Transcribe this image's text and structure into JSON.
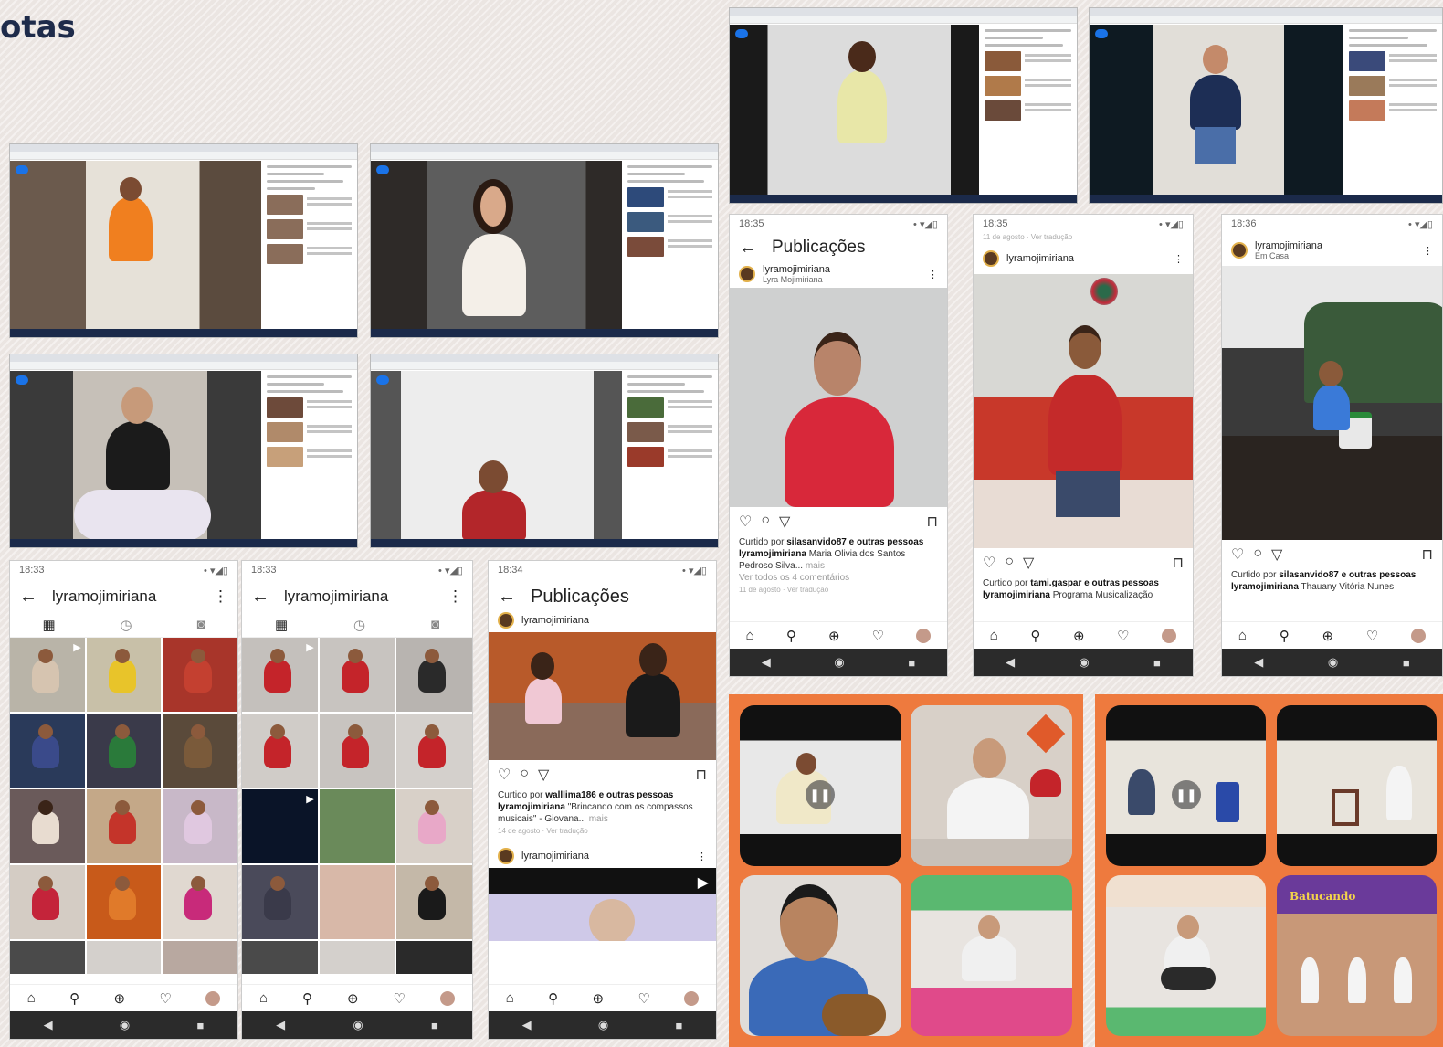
{
  "page": {
    "title": "otas"
  },
  "phones": {
    "p1": {
      "time": "18:33",
      "status": "• ▾◢▯",
      "username": "lyramojimiriana"
    },
    "p2": {
      "time": "18:33",
      "status": "• ▾◢▯",
      "username": "lyramojimiriana"
    },
    "p3": {
      "time": "18:34",
      "status": "• ▾◢▯",
      "header": "Publicações",
      "account": "lyramojimiriana",
      "liked_prefix": "Curtido por",
      "liked_user": "walllima186",
      "liked_suffix": "e outras pessoas",
      "caption_user": "lyramojimiriana",
      "caption_text": "\"Brincando com os compassos musicais\" - Giovana...",
      "more": "mais",
      "date": "14 de agosto · Ver tradução",
      "account2": "lyramojimiriana"
    },
    "p4": {
      "time": "18:35",
      "status": "• ▾◢▯",
      "header": "Publicações",
      "account": "lyramojimiriana",
      "account_sub": "Lyra Mojimiriana",
      "liked_prefix": "Curtido por",
      "liked_user": "silasanvido87",
      "liked_suffix": "e outras pessoas",
      "caption_user": "lyramojimiriana",
      "caption_text": "Maria Olivia dos Santos Pedroso Silva...",
      "more": "mais",
      "comments": "Ver todos os 4 comentários",
      "date": "11 de agosto · Ver tradução"
    },
    "p5": {
      "time": "18:35",
      "status": "• ▾◢▯",
      "top_text": "11 de agosto · Ver tradução",
      "account": "lyramojimiriana",
      "liked_prefix": "Curtido por",
      "liked_user": "tami.gaspar",
      "liked_suffix": "e outras pessoas",
      "caption_user": "lyramojimiriana",
      "caption_text": "Programa Musicalização"
    },
    "p6": {
      "time": "18:36",
      "status": "• ▾◢▯",
      "account": "lyramojimiriana",
      "account_sub": "Em Casa",
      "liked_prefix": "Curtido por",
      "liked_user": "silasanvido87",
      "liked_suffix": "e outras pessoas",
      "caption_user": "lyramojimiriana",
      "caption_text": "Thauany Vitória Nunes"
    }
  },
  "icons": {
    "back": "←",
    "more": "⋮",
    "grid": "▦",
    "reels": "◷",
    "tagged": "◙",
    "heart": "♡",
    "comment": "○",
    "share": "▽",
    "save": "⊓",
    "home": "⌂",
    "search": "⚲",
    "add": "⊕",
    "sys_back": "◀",
    "sys_home": "◉",
    "sys_recent": "■",
    "play": "▶",
    "pause": "❚❚"
  },
  "collage": {
    "banner_text": "Batucando"
  }
}
